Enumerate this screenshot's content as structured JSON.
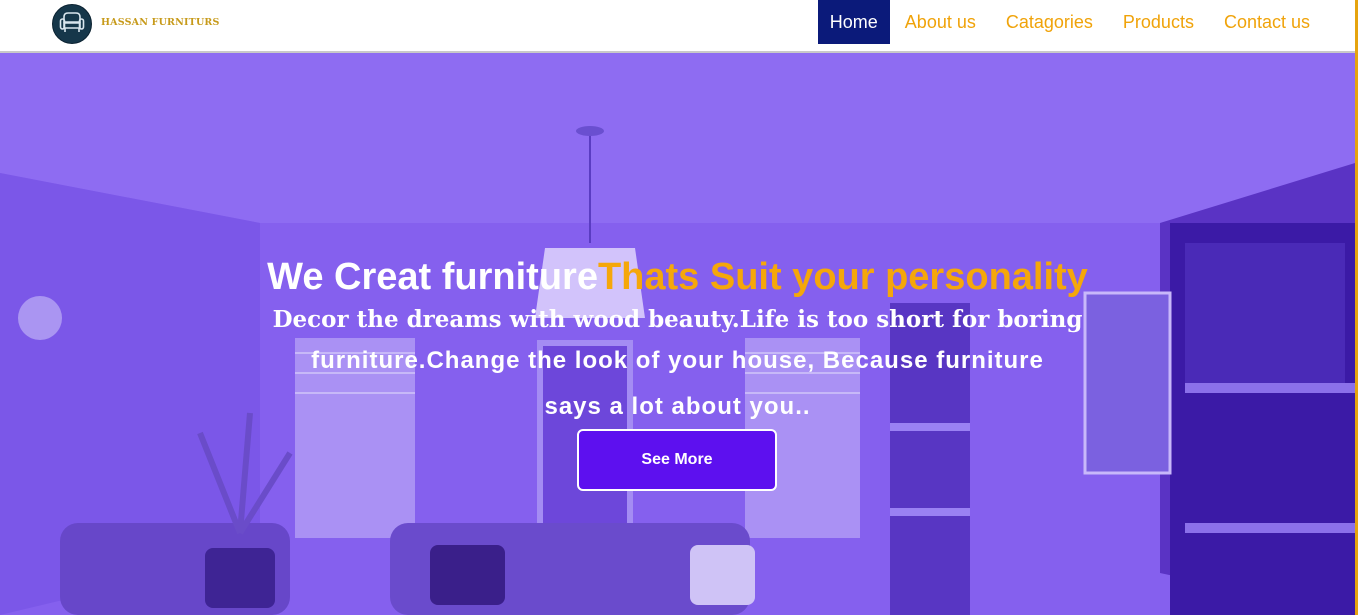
{
  "brand": {
    "name": "HASSAN FURNITURS",
    "logo_icon": "armchair-icon"
  },
  "nav": {
    "items": [
      {
        "label": "Home",
        "active": true
      },
      {
        "label": "About us",
        "active": false
      },
      {
        "label": "Catagories",
        "active": false
      },
      {
        "label": "Products",
        "active": false
      },
      {
        "label": "Contact us",
        "active": false
      }
    ]
  },
  "hero": {
    "headline_white": "We Creat furniture",
    "headline_accent": "Thats Suit your personality",
    "tagline_line1": "Decor the dreams with wood beauty.Life is too short for boring",
    "tagline_line2": "furniture.Change the look of your house, Because furniture",
    "tagline_line3": "says a lot about you..",
    "cta_label": "See More"
  },
  "colors": {
    "accent": "#f5a70a",
    "nav_active_bg": "#0b1a7a",
    "hero_tint": "#7f5bef",
    "cta_bg": "#5d10ef",
    "logo_bg": "#16374a"
  }
}
